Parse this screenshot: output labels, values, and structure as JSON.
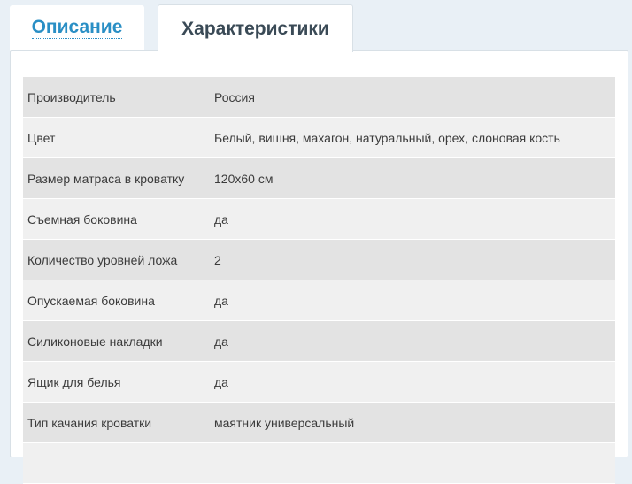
{
  "tabs": [
    {
      "label": "Описание",
      "active": false
    },
    {
      "label": "Характеристики",
      "active": true
    }
  ],
  "specs": [
    {
      "key": "Производитель",
      "value": "Россия"
    },
    {
      "key": "Цвет",
      "value": "Белый, вишня, махагон, натуральный, орех, слоновая кость"
    },
    {
      "key": "Размер матраса в кроватку",
      "value": "120х60 см"
    },
    {
      "key": "Съемная боковина",
      "value": "да"
    },
    {
      "key": "Количество уровней ложа",
      "value": "2"
    },
    {
      "key": "Опускаемая боковина",
      "value": "да"
    },
    {
      "key": "Силиконовые накладки",
      "value": "да"
    },
    {
      "key": "Ящик для белья",
      "value": "да"
    },
    {
      "key": "Тип качания кроватки",
      "value": "маятник универсальный"
    },
    {
      "key": "",
      "value": ""
    }
  ],
  "colors": {
    "link_blue": "#2a8fc5",
    "active_tab_text": "#3a4a56",
    "page_bg": "#e9f0f6",
    "row_odd": "#e3e3e3",
    "row_even": "#f0f0f0"
  }
}
